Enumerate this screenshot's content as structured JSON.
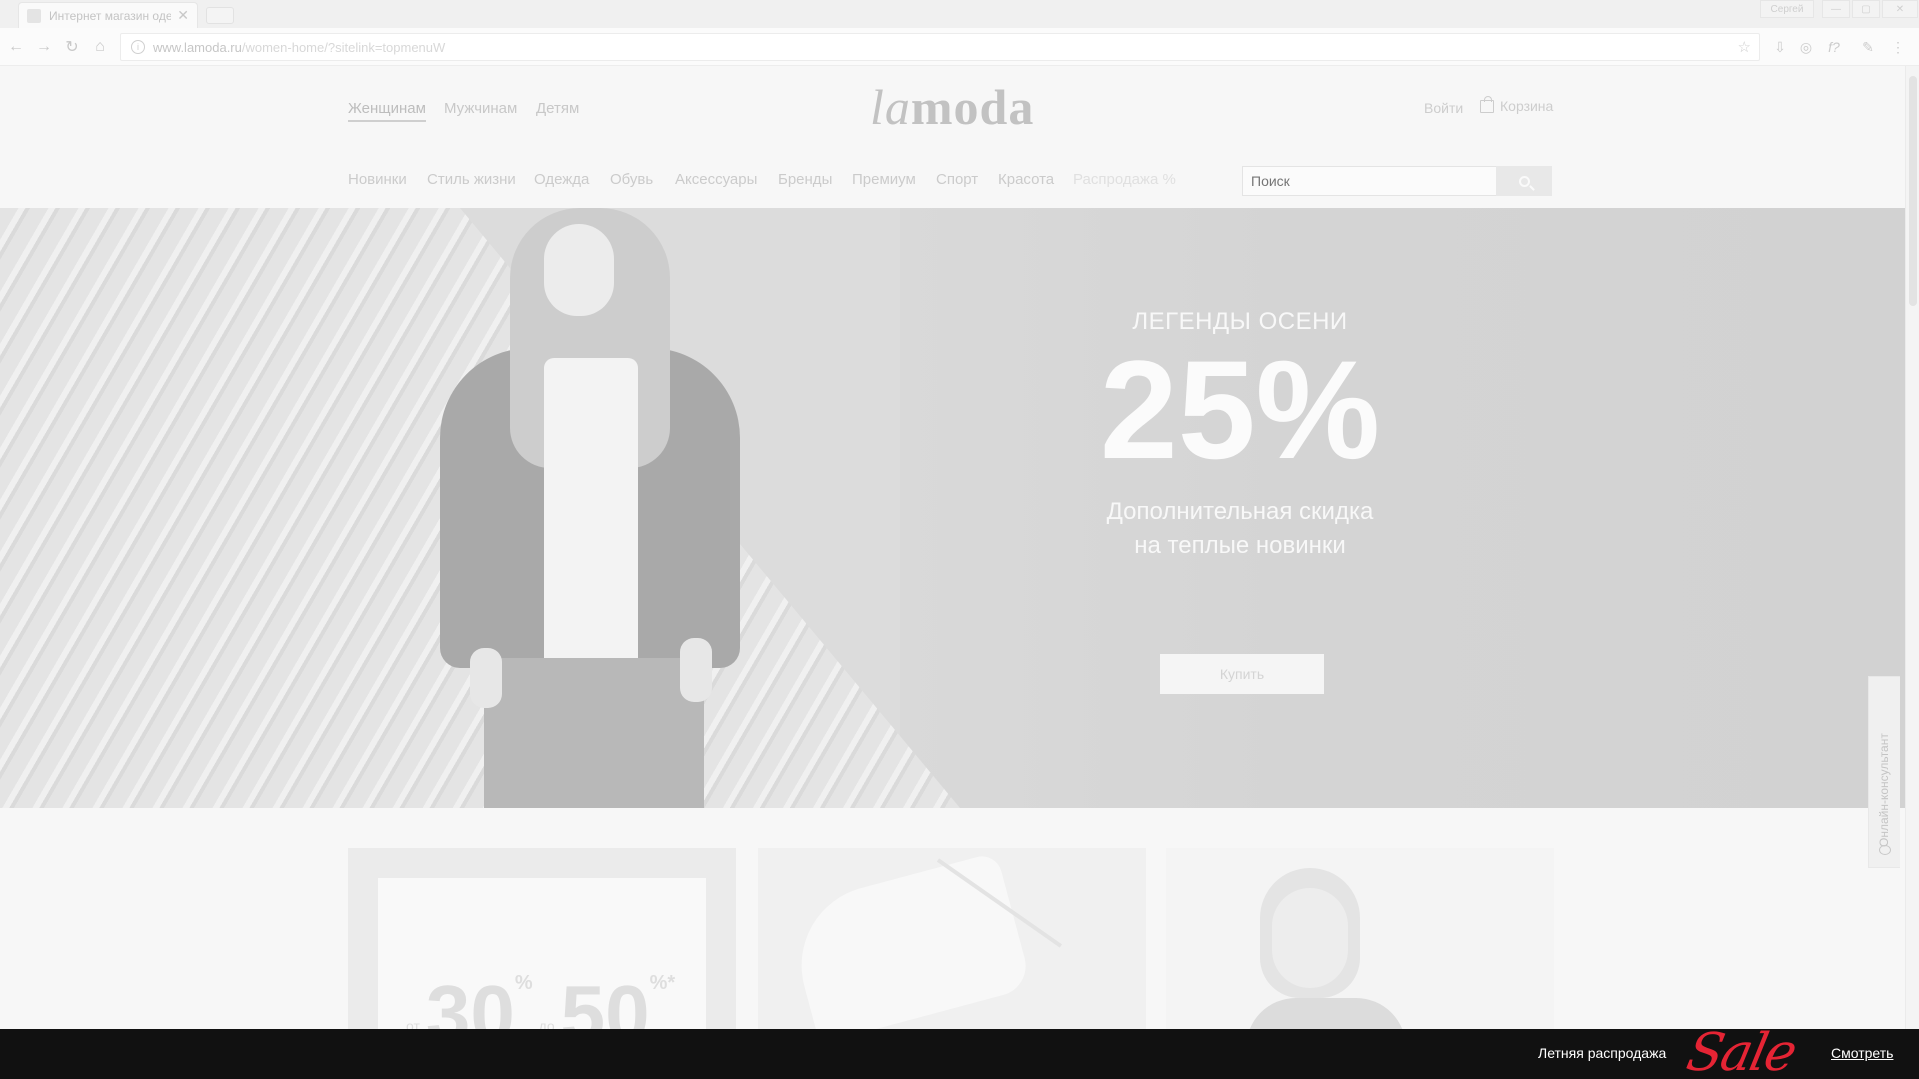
{
  "browser": {
    "tab_title": "Интернет магазин оде...",
    "user_button": "Сергей",
    "url_host": "www.lamoda.ru",
    "url_path": "/women-home/?sitelink=topmenuW",
    "info_glyph": "i",
    "star_glyph": "☆",
    "ext_icons": [
      "download-icon",
      "globe-icon",
      "fx-icon",
      "eyedropper-icon",
      "kebab-menu-icon"
    ]
  },
  "header": {
    "genders": [
      {
        "label": "Женщинам",
        "active": true
      },
      {
        "label": "Мужчинам",
        "active": false
      },
      {
        "label": "Детям",
        "active": false
      }
    ],
    "logo_light": "la",
    "logo_bold": "moda",
    "login": "Войти",
    "cart": "Корзина"
  },
  "categories": [
    "Новинки",
    "Стиль жизни",
    "Одежда",
    "Обувь",
    "Аксессуары",
    "Бренды",
    "Премиум",
    "Спорт",
    "Красота",
    "Распродажа %"
  ],
  "search": {
    "placeholder": "Поиск"
  },
  "hero": {
    "kicker": "ЛЕГЕНДЫ ОСЕНИ",
    "big": "25%",
    "sub1": "Дополнительная скидка",
    "sub2": "на теплые новинки",
    "button": "Купить"
  },
  "cards": {
    "promo": {
      "from": "от",
      "v1": "30",
      "pct": "%",
      "to": "до",
      "v2": "50",
      "star": "*"
    }
  },
  "consultant": {
    "label": "Онлайн-консультант"
  },
  "bottom": {
    "text": "Летняя распродажа",
    "sale": "Sale",
    "link": "Смотреть"
  },
  "colors": {
    "sale_red": "#e52434",
    "bar": "#111111"
  }
}
